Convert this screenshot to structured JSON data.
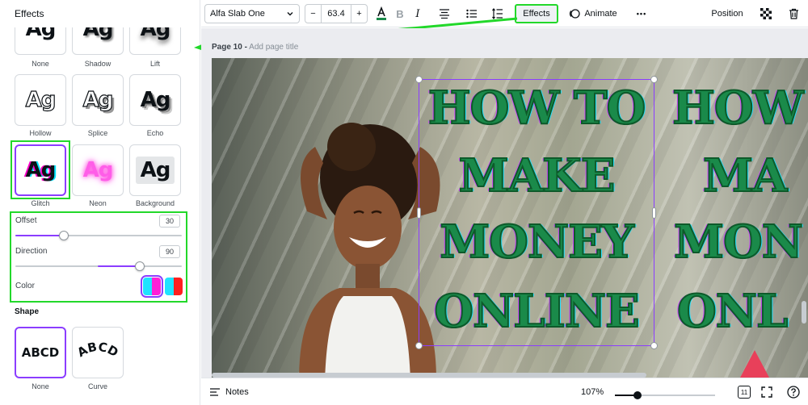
{
  "panel": {
    "title": "Effects",
    "effects": [
      {
        "label": "None",
        "sample": "Ag"
      },
      {
        "label": "Shadow",
        "sample": "Ag"
      },
      {
        "label": "Lift",
        "sample": "Ag"
      },
      {
        "label": "Hollow",
        "sample": "Ag"
      },
      {
        "label": "Splice",
        "sample": "Ag"
      },
      {
        "label": "Echo",
        "sample": "Ag"
      },
      {
        "label": "Glitch",
        "sample": "Ag"
      },
      {
        "label": "Neon",
        "sample": "Ag"
      },
      {
        "label": "Background",
        "sample": "Ag"
      }
    ],
    "selected_effect": "Glitch",
    "settings": {
      "offset_label": "Offset",
      "offset_value": "30",
      "direction_label": "Direction",
      "direction_value": "90",
      "color_label": "Color",
      "color_swatches": [
        {
          "left": "#1fe3ff",
          "right": "#ff1fd8",
          "selected": true
        },
        {
          "left": "#1fe3ff",
          "right": "#ff1f1f",
          "selected": false
        }
      ]
    },
    "shape": {
      "title": "Shape",
      "options": [
        {
          "label": "None",
          "sample": "ABCD"
        },
        {
          "label": "Curve",
          "sample": "ABCD"
        }
      ]
    }
  },
  "toolbar": {
    "font_name": "Alfa Slab One",
    "font_size": "63.4",
    "minus": "−",
    "plus": "+",
    "effects_label": "Effects",
    "animate_label": "Animate",
    "position_label": "Position",
    "more": "•••"
  },
  "canvas": {
    "page_label": "Page 10 -",
    "page_title_placeholder": "Add page title",
    "headline_lines": [
      "HOW TO",
      "MAKE",
      "MONEY",
      "ONLINE"
    ],
    "duplicate_lines": [
      "HOW",
      "MA",
      "MON",
      "ONL"
    ],
    "headline_color": "#1a8a4a",
    "accent": "#8b3dff"
  },
  "bottom_bar": {
    "notes_label": "Notes",
    "zoom": "107%",
    "page_count": "11"
  }
}
